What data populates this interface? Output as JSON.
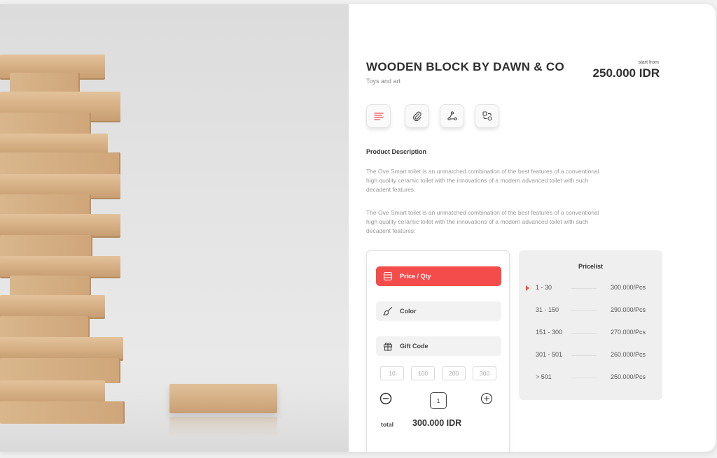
{
  "product": {
    "title": "WOODEN BLOCK BY DAWN & CO",
    "category": "Toys and art",
    "price_prefix": "start from",
    "price": "250.000 IDR"
  },
  "icon_buttons": [
    {
      "name": "description-icon",
      "active": true
    },
    {
      "name": "attachment-icon",
      "active": false
    },
    {
      "name": "share-icon",
      "active": false
    },
    {
      "name": "compare-icon",
      "active": false
    }
  ],
  "description": {
    "heading": "Product Description",
    "paragraphs": [
      "The Ove Smart toilet is an unmatched combination of the best features of a conventional high quality ceramic toilet with the innovations of a modern advanced toilet with such decadent features.",
      "The Ove Smart toilet is an unmatched combination of the best features of a conventional high quality ceramic toilet with the innovations of a modern advanced toilet with such decadent features."
    ]
  },
  "options": {
    "price_qty": {
      "label": "Price / Qty",
      "icon": "list-icon"
    },
    "color": {
      "label": "Color",
      "icon": "brush-icon"
    },
    "gift_code": {
      "label": "Gift Code",
      "icon": "gift-icon"
    }
  },
  "quantity": {
    "presets": [
      "10",
      "100",
      "200",
      "300"
    ],
    "value": "1",
    "total_label": "total",
    "total_value": "300.000 IDR"
  },
  "pricelist": {
    "title": "Pricelist",
    "rows": [
      {
        "range": "1 - 30",
        "price": "300.000/Pcs",
        "active": true
      },
      {
        "range": "31 - 150",
        "price": "290.000/Pcs",
        "active": false
      },
      {
        "range": "151 - 300",
        "price": "270.000/Pcs",
        "active": false
      },
      {
        "range": "301 - 501",
        "price": "260.000/Pcs",
        "active": false
      },
      {
        "range": "> 501",
        "price": "250.000/Pcs",
        "active": false
      }
    ]
  },
  "colors": {
    "accent": "#f44b4b",
    "text_dark": "#2f2f2f",
    "text_muted": "#999999",
    "panel_bg": "#efefef"
  }
}
